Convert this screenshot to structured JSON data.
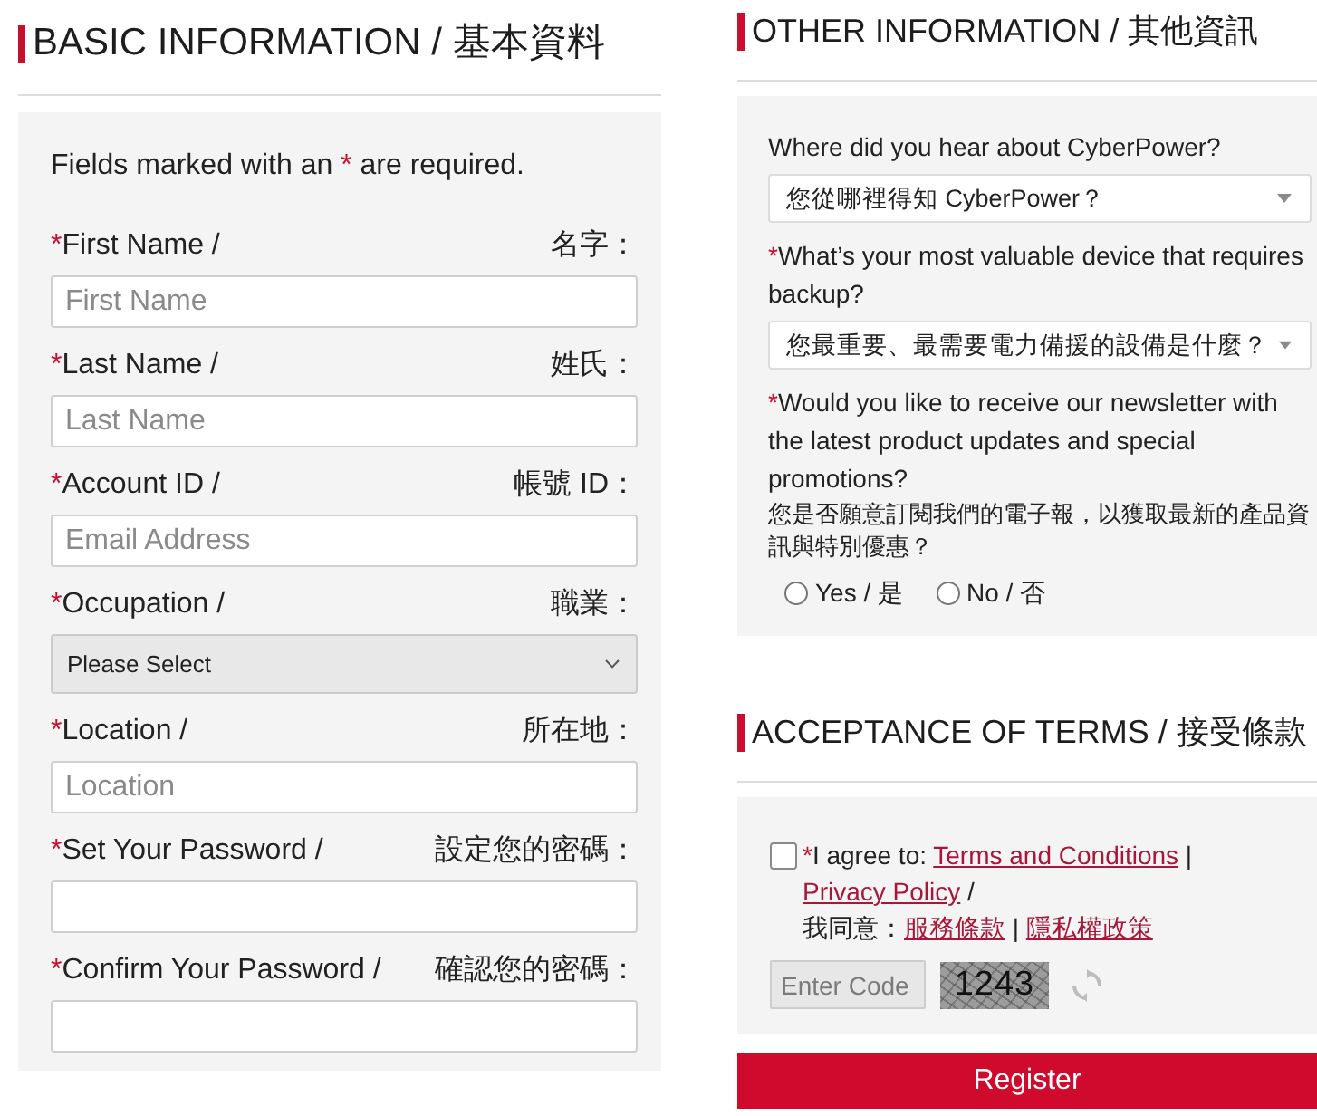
{
  "basic_information": {
    "title": "BASIC INFORMATION / 基本資料",
    "notice": {
      "text_before": "Fields marked with an",
      "mark": "*",
      "text_after": "are required."
    },
    "fields": [
      {
        "kind": "input",
        "mark": "*",
        "label": "First Name /",
        "label_zh": "名字：",
        "placeholder": "First Name"
      },
      {
        "kind": "input",
        "mark": "*",
        "label": "Last Name /",
        "label_zh": "姓氏：",
        "placeholder": "Last Name"
      },
      {
        "kind": "input",
        "mark": "*",
        "label": "Account ID /",
        "label_zh": "帳號 ID：",
        "placeholder": "Email Address"
      },
      {
        "kind": "select",
        "mark": "*",
        "label": "Occupation /",
        "label_zh": "職業：",
        "value": "Please Select"
      },
      {
        "kind": "input",
        "mark": "*",
        "label": "Location /",
        "label_zh": "所在地：",
        "placeholder": "Location"
      },
      {
        "kind": "input",
        "mark": "*",
        "label": "Set Your Password /",
        "label_zh": "設定您的密碼："
      },
      {
        "kind": "input",
        "mark": "*",
        "label": "Confirm Your Password /",
        "label_zh": "確認您的密碼："
      }
    ]
  },
  "other_information": {
    "title": "OTHER INFORMATION / 其他資訊",
    "questions": [
      {
        "kind": "select",
        "label": "Where did you hear about CyberPower?",
        "value": "您從哪裡得知 CyberPower？"
      },
      {
        "kind": "select",
        "mark": "*",
        "label": "What’s your most valuable device that requires backup?",
        "value": "您最重要、最需要電力備援的設備是什麼？"
      },
      {
        "kind": "radio",
        "mark": "*",
        "label": "Would you like to receive our newsletter with the latest product updates and special promotions?",
        "label_zh": "您是否願意訂閱我們的電子報，以獲取最新的產品資訊與特別優惠？",
        "options": [
          {
            "label": "Yes / 是",
            "selected": false
          },
          {
            "label": "No / 否",
            "selected": false
          }
        ]
      }
    ]
  },
  "acceptance_of_terms": {
    "title": "ACCEPTANCE OF TERMS / 接受條款",
    "agreement": {
      "checked": false,
      "lines": [
        [
          {
            "kind": "mark",
            "text": "*"
          },
          {
            "kind": "text",
            "text": "I agree to: "
          },
          {
            "kind": "link",
            "text": "Terms and Conditions"
          },
          {
            "kind": "text",
            "text": " | "
          },
          {
            "kind": "link",
            "text": "Privacy Policy"
          },
          {
            "kind": "text",
            "text": " /"
          }
        ],
        [
          {
            "kind": "text",
            "text": "我同意："
          },
          {
            "kind": "link",
            "text": "服務條款"
          },
          {
            "kind": "text",
            "text": " | "
          },
          {
            "kind": "link",
            "text": "隱私權政策"
          }
        ]
      ]
    },
    "code_field": {
      "placeholder": "Enter Code"
    },
    "captcha": {
      "code": "1243"
    }
  },
  "register_button": {
    "label": "Register"
  }
}
